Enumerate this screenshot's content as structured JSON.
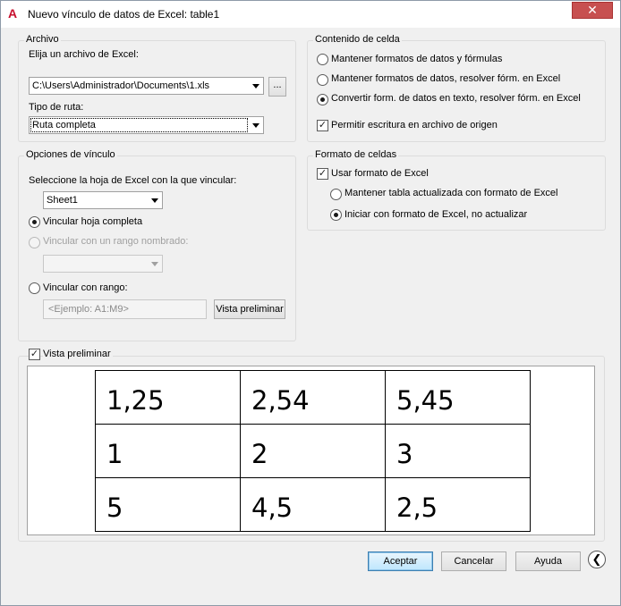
{
  "window": {
    "title": "Nuevo vínculo de datos de Excel: table1",
    "close_glyph": "✕"
  },
  "archivo": {
    "legend": "Archivo",
    "choose_label": "Elija un archivo de Excel:",
    "file_value": "C:\\Users\\Administrador\\Documents\\1.xls",
    "browse_label": "...",
    "path_type_label": "Tipo de ruta:",
    "path_type_value": "Ruta completa"
  },
  "opciones": {
    "legend": "Opciones de vínculo",
    "sheet_label": "Seleccione la hoja de Excel con la que vincular:",
    "sheet_value": "Sheet1",
    "radio_full": "Vincular hoja completa",
    "radio_named": "Vincular con un rango nombrado:",
    "radio_range": "Vincular con rango:",
    "range_placeholder": "<Ejemplo: A1:M9>",
    "preview_button": "Vista preliminar"
  },
  "contenido": {
    "legend": "Contenido de celda",
    "opt1": "Mantener formatos de datos y fórmulas",
    "opt2": "Mantener formatos de datos, resolver fórm. en Excel",
    "opt3": "Convertir form. de datos en texto, resolver fórm. en Excel",
    "allow_write": "Permitir escritura en archivo de origen"
  },
  "formato": {
    "legend": "Formato de celdas",
    "use_excel_format": "Usar formato de Excel",
    "keep_updated": "Mantener tabla actualizada con formato de Excel",
    "start_excel": "Iniciar con formato de Excel, no actualizar"
  },
  "preview": {
    "label": "Vista preliminar",
    "rows": [
      [
        "1,25",
        "2,54",
        "5,45"
      ],
      [
        "1",
        "2",
        "3"
      ],
      [
        "5",
        "4,5",
        "2,5"
      ]
    ]
  },
  "buttons": {
    "ok": "Aceptar",
    "cancel": "Cancelar",
    "help": "Ayuda",
    "collapse_glyph": "❮"
  },
  "icons": {
    "app": "autocad-app-icon",
    "collapse": "collapse-arrow-icon"
  }
}
